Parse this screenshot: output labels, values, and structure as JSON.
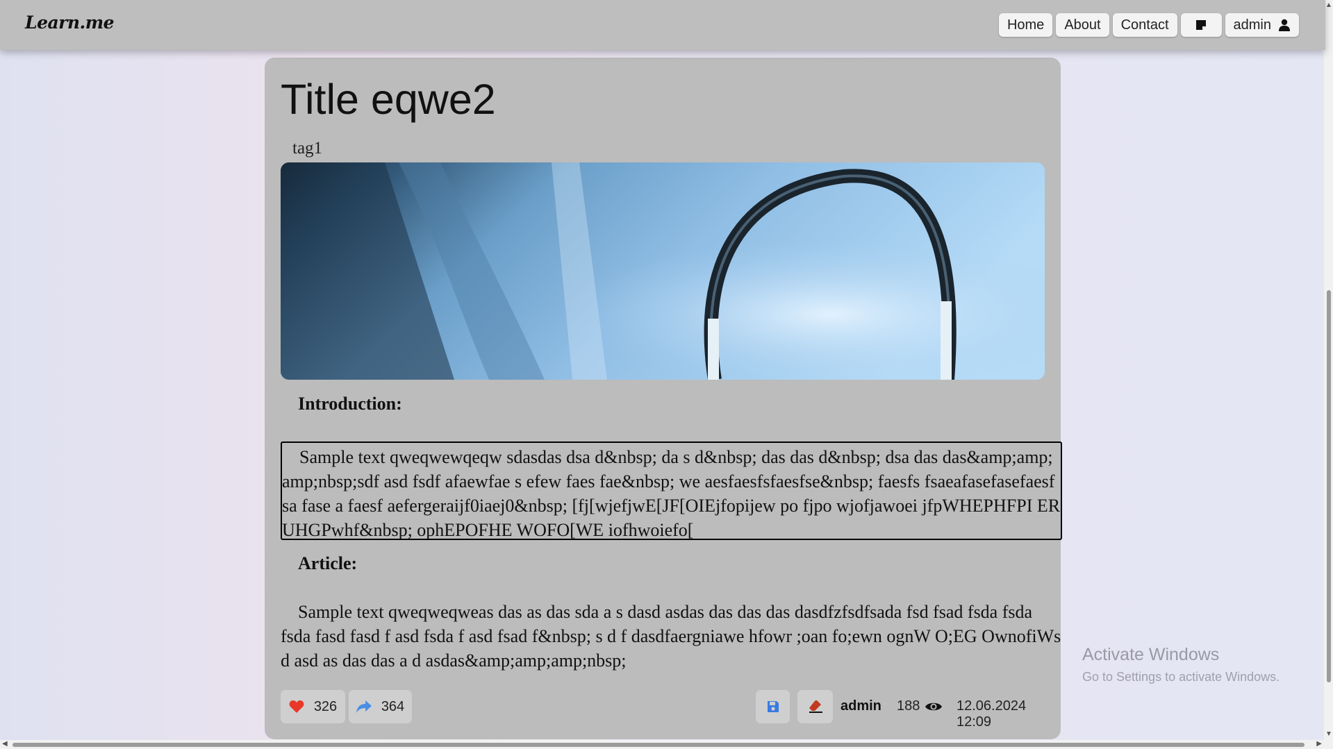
{
  "navbar": {
    "logo": "Learn.me",
    "home": "Home",
    "about": "About",
    "contact": "Contact",
    "user": "admin"
  },
  "post": {
    "title": "Title eqwe2",
    "tag": "tag1",
    "intro_heading": "Introduction:",
    "intro_text": "Sample text qweqwewqeqw sdasdas dsa d&nbsp; da s d&nbsp; das das d&nbsp; dsa das das&amp;amp;amp;nbsp;sdf asd fsdf afaewfae s efew faes fae&nbsp; we aesfaesfsfaesfse&nbsp; faesfs fsaeafasefasefaesfsa fase a faesf aefergeraijf0iaej0&nbsp; [fj[wjefjwE[JF[OIEjfopijew po fjpo wjofjawoei jfpWHEPHFPI ERUHGPwhf&nbsp; ophEPOFHE WOFO[WE iofhwoiefo[",
    "article_heading": "Article:",
    "article_text": "Sample text qweqweqweas das as das sda a s dasd asdas das das das dasdfzfsdfsada fsd fsad fsda fsda fsda fasd fasd f asd fsda f asd fsad f&nbsp; s d f dasdfaergniawe hfowr ;oan fo;ewn ognW O;EG OwnofiWs d asd as das das a d asdas&amp;amp;amp;nbsp;"
  },
  "footer": {
    "likes": "326",
    "shares": "364",
    "author": "admin",
    "views": "188",
    "date": "12.06.2024 12:09"
  },
  "watermark": {
    "line1": "Activate Windows",
    "line2": "Go to Settings to activate Windows."
  },
  "colors": {
    "heart": "#e8382a",
    "share": "#4a8ee6",
    "save": "#3a7be0",
    "erase": "#c0391f"
  }
}
